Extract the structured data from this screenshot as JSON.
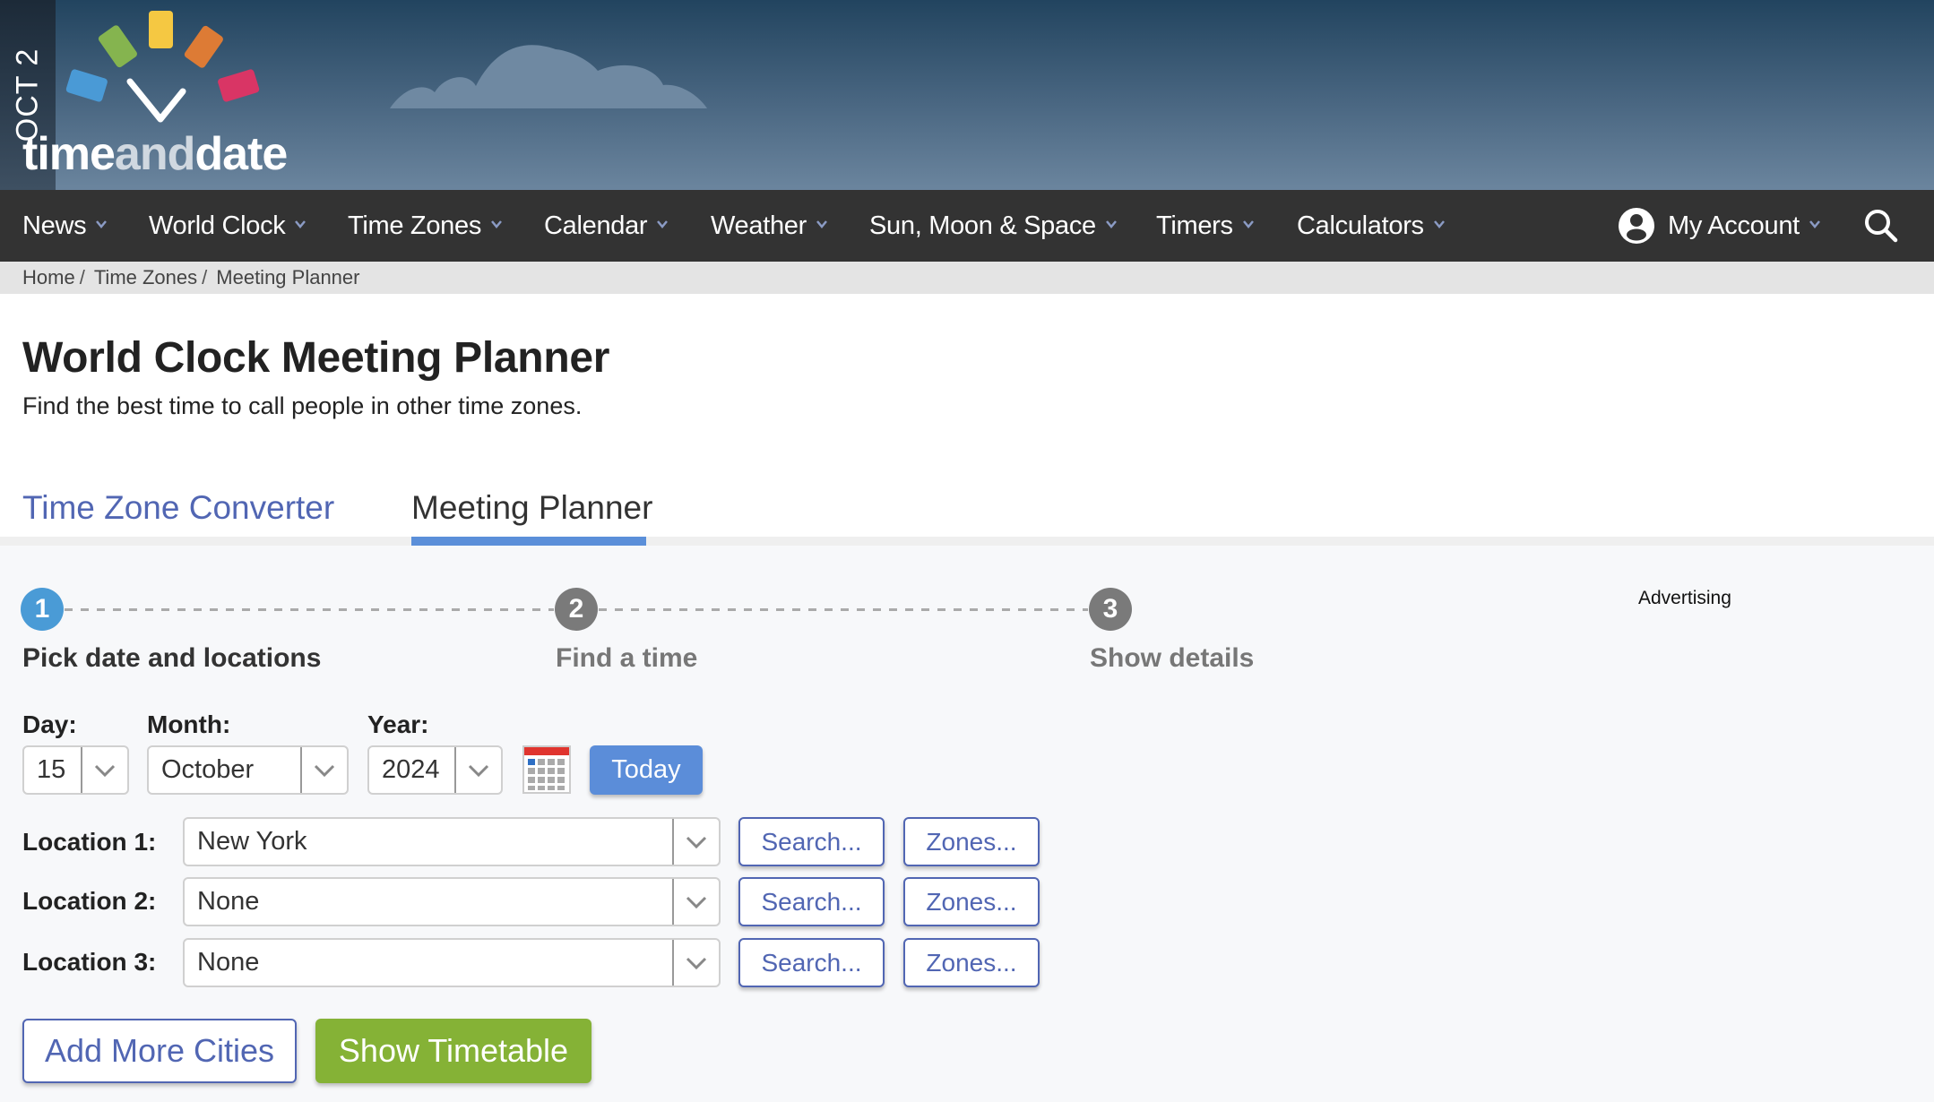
{
  "header": {
    "date_badge": "OCT 2",
    "logo": {
      "word_time": "time",
      "word_and": "and",
      "word_date": "date"
    }
  },
  "nav": {
    "items": [
      {
        "label": "News",
        "icon": "chevron-down-icon"
      },
      {
        "label": "World Clock",
        "icon": "chevron-down-icon"
      },
      {
        "label": "Time Zones",
        "icon": "chevron-down-icon"
      },
      {
        "label": "Calendar",
        "icon": "chevron-down-icon"
      },
      {
        "label": "Weather",
        "icon": "chevron-down-icon"
      },
      {
        "label": "Sun, Moon & Space",
        "icon": "chevron-down-icon"
      },
      {
        "label": "Timers",
        "icon": "chevron-down-icon"
      },
      {
        "label": "Calculators",
        "icon": "chevron-down-icon"
      }
    ],
    "account": {
      "label": "My Account",
      "icon": "user-circle-icon"
    },
    "search_icon": "search-icon"
  },
  "breadcrumb": [
    "Home",
    "Time Zones",
    "Meeting Planner"
  ],
  "breadcrumb_separator": "/",
  "page": {
    "title": "World Clock Meeting Planner",
    "subtitle": "Find the best time to call people in other time zones."
  },
  "tabs": [
    {
      "label": "Time Zone Converter",
      "active": false
    },
    {
      "label": "Meeting Planner",
      "active": true
    }
  ],
  "steps": [
    {
      "number": "1",
      "label": "Pick date and locations",
      "active": true
    },
    {
      "number": "2",
      "label": "Find a time",
      "active": false
    },
    {
      "number": "3",
      "label": "Show details",
      "active": false
    }
  ],
  "advertising_label": "Advertising",
  "date_form": {
    "day_label": "Day:",
    "day_value": "15",
    "month_label": "Month:",
    "month_value": "October",
    "year_label": "Year:",
    "year_value": "2024",
    "calendar_icon": "calendar-icon",
    "today_label": "Today"
  },
  "locations": [
    {
      "label": "Location 1:",
      "value": "New York",
      "search_label": "Search...",
      "zones_label": "Zones..."
    },
    {
      "label": "Location 2:",
      "value": "None",
      "search_label": "Search...",
      "zones_label": "Zones..."
    },
    {
      "label": "Location 3:",
      "value": "None",
      "search_label": "Search...",
      "zones_label": "Zones..."
    }
  ],
  "actions": {
    "add_more_label": "Add More Cities",
    "show_timetable_label": "Show Timetable"
  },
  "colors": {
    "link_blue": "#5166b3",
    "active_tab": "#5b8fd9",
    "step_active": "#4a9bd6",
    "step_inactive": "#7a7a7a",
    "today_button": "#5b8dd9",
    "timetable_button": "#85b236",
    "nav_bg": "#333333"
  }
}
